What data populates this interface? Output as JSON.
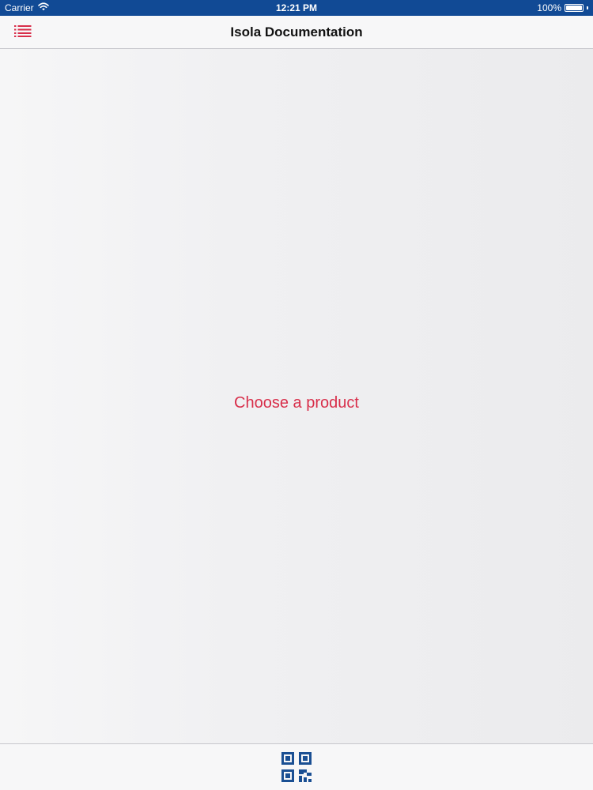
{
  "status_bar": {
    "carrier": "Carrier",
    "time": "12:21 PM",
    "battery_text": "100%",
    "battery_level": 1.0
  },
  "nav_bar": {
    "title": "Isola Documentation",
    "menu_icon": "list-icon"
  },
  "content": {
    "placeholder": "Choose a product"
  },
  "toolbar": {
    "qr_icon": "qr-code-icon"
  },
  "colors": {
    "status_bar_bg": "#114a95",
    "accent": "#d82e4a",
    "qr_blue": "#1a4f93",
    "bar_bg": "#f7f7f8"
  }
}
